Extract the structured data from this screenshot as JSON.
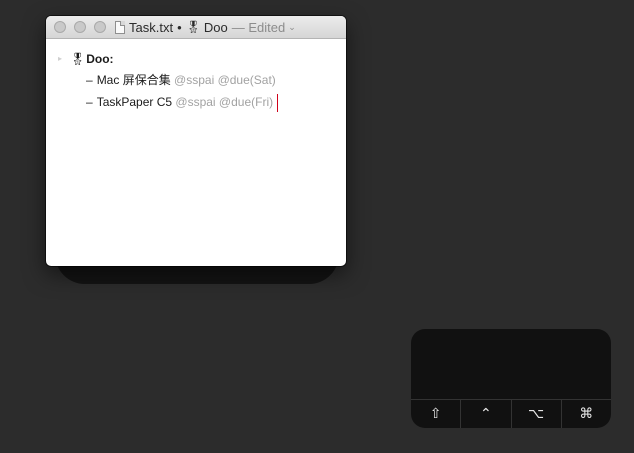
{
  "window": {
    "title": {
      "filename": "Task.txt",
      "separator": "•",
      "project_icon": "medal-icon",
      "project_name": "Doo",
      "status": "— Edited",
      "chevron_icon": "chevron-down-icon"
    },
    "traffic_lights": [
      "close",
      "minimize",
      "zoom"
    ],
    "document": {
      "project": {
        "icon": "medal-icon",
        "name": "Doo:"
      },
      "tasks": [
        {
          "dash": "–",
          "text": "Mac 屏保合集",
          "tags": "@sspai @due(Sat)"
        },
        {
          "dash": "–",
          "text": "TaskPaper C5",
          "tags": "@sspai @due(Fri)"
        }
      ]
    }
  },
  "keypad": {
    "keys": [
      {
        "name": "shift",
        "glyph": "⇧"
      },
      {
        "name": "control",
        "glyph": "⌃"
      },
      {
        "name": "option",
        "glyph": "⌥"
      },
      {
        "name": "command",
        "glyph": "⌘"
      }
    ]
  },
  "colors": {
    "desktop_background": "#2c2c2c",
    "tag_text": "#a2a2a2",
    "cursor": "#d0021b",
    "keypad_background": "#111111"
  }
}
